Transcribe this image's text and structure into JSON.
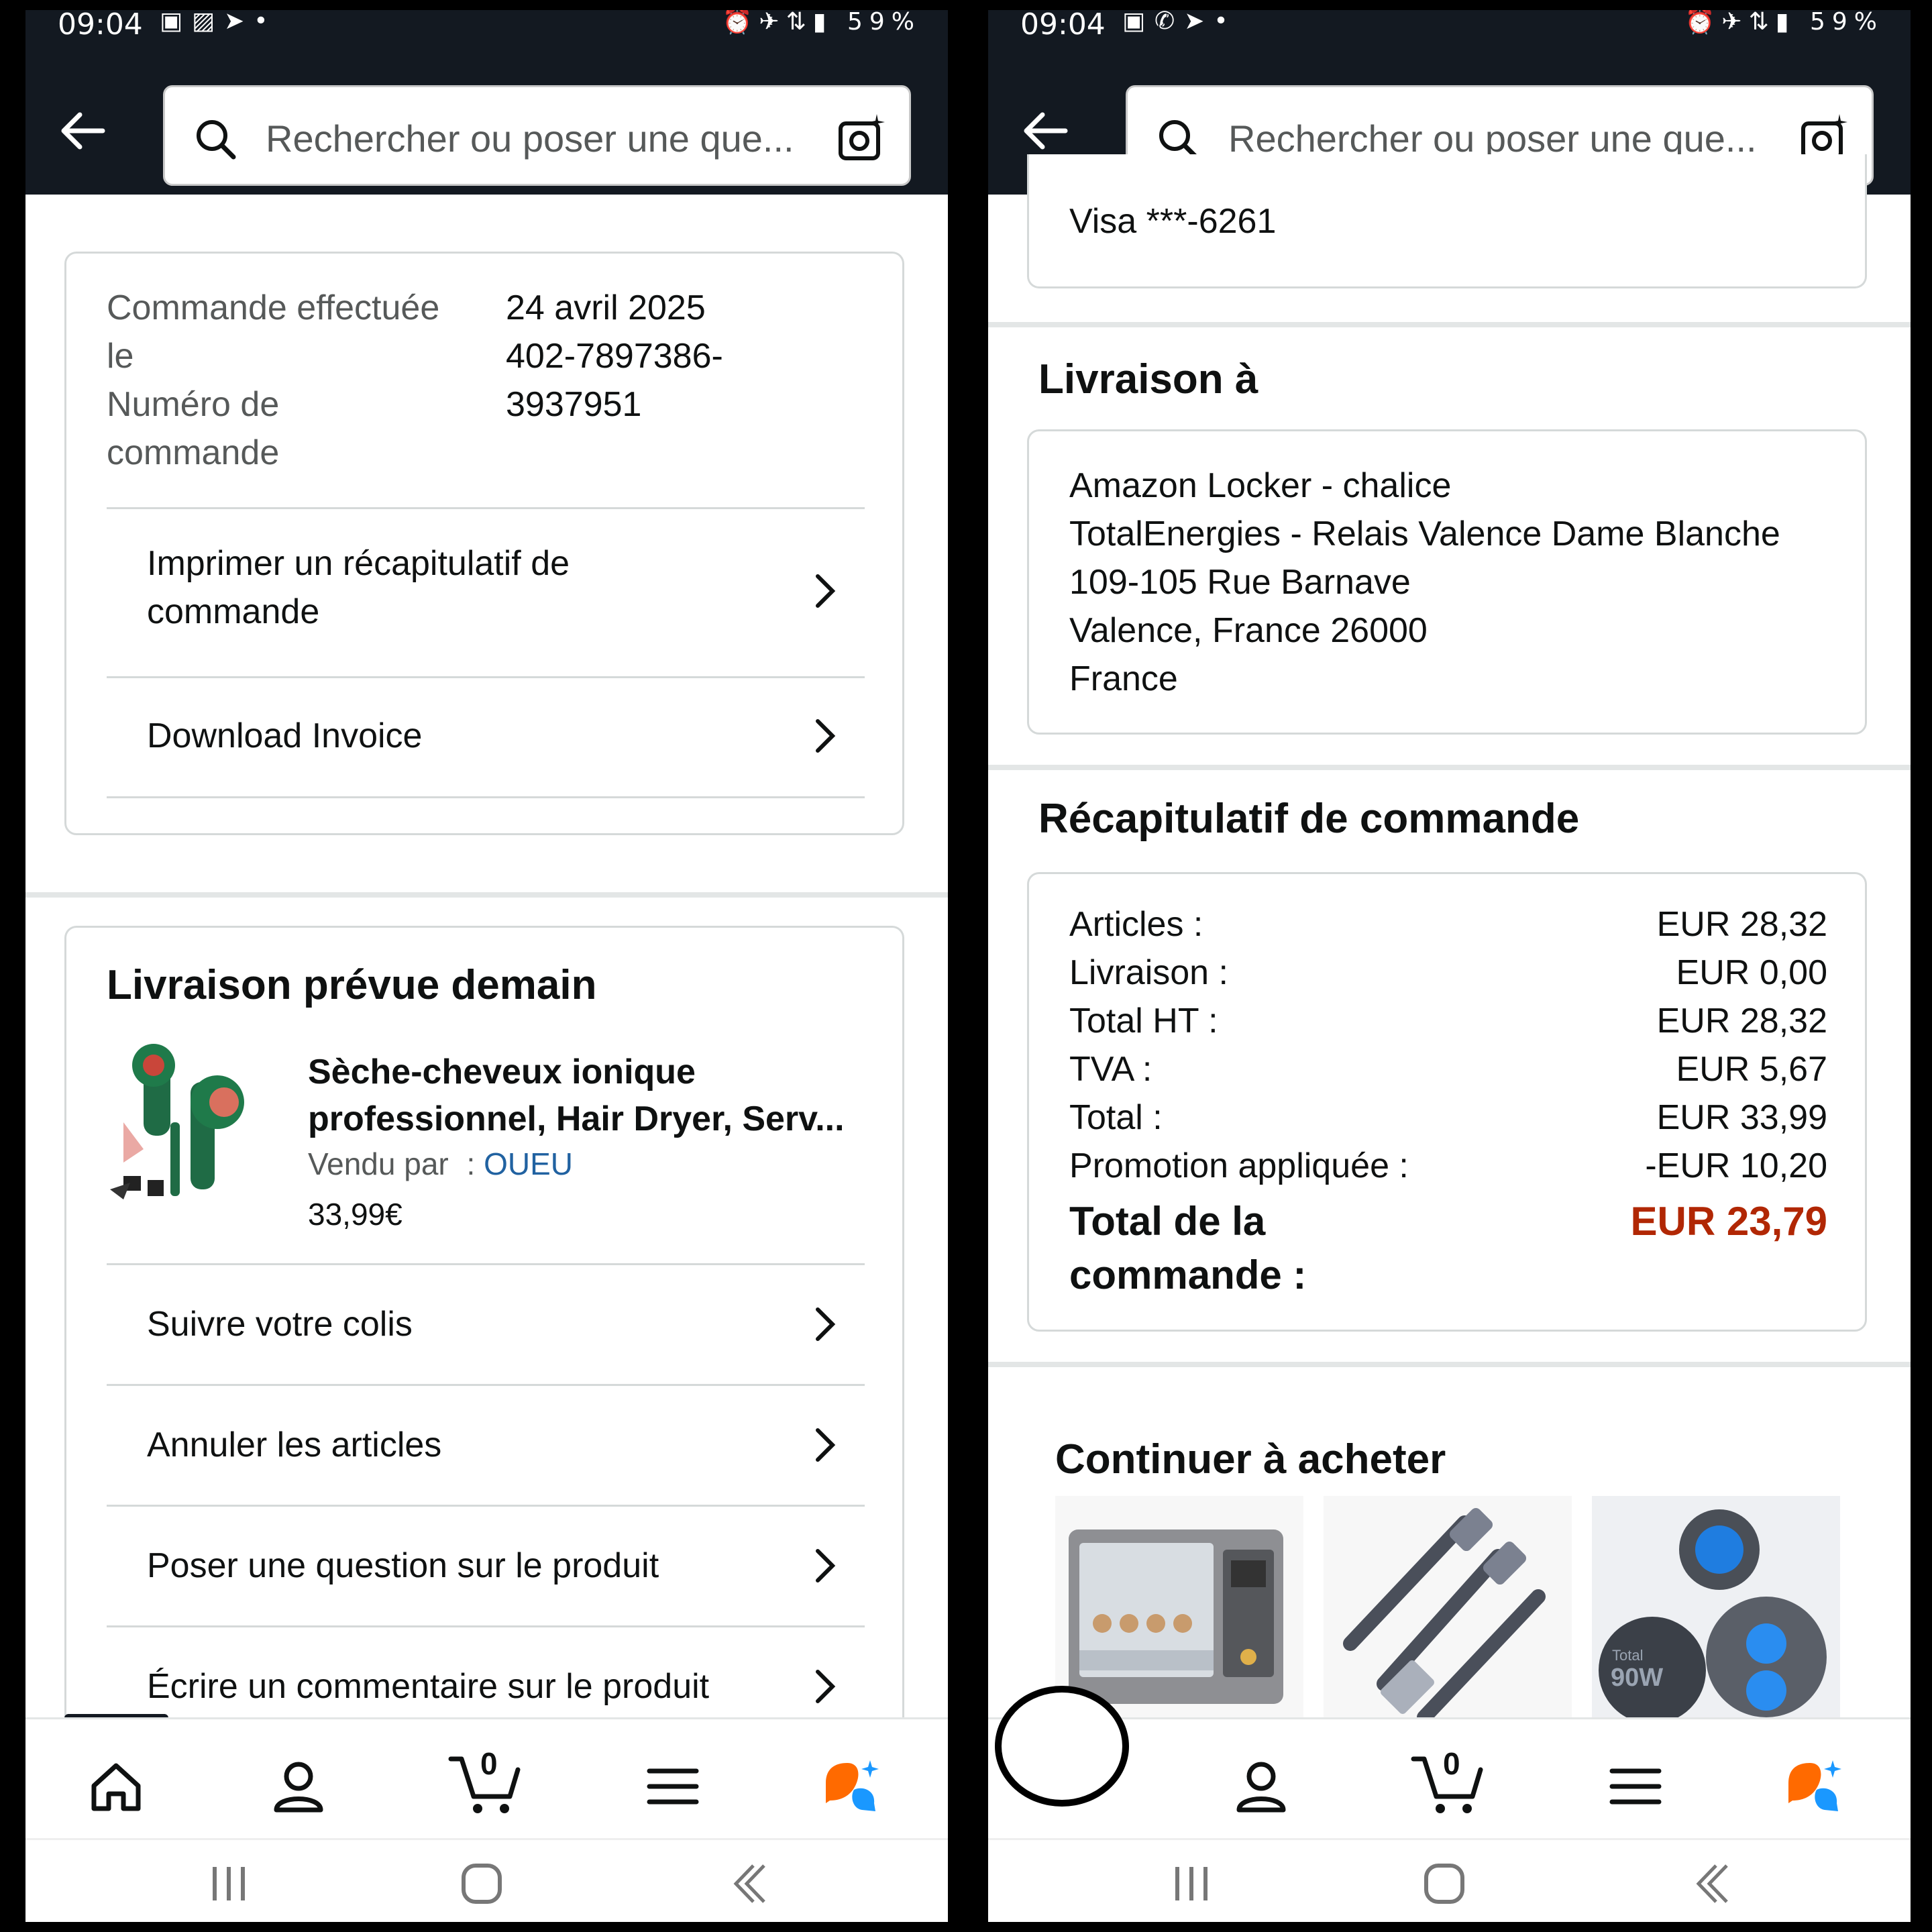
{
  "status": {
    "time": "09:04",
    "battery": "59%"
  },
  "search": {
    "placeholder": "Rechercher ou poser une que..."
  },
  "order": {
    "placed_label": "Commande effectuée le",
    "placed_label_l1": "Commande effectuée",
    "placed_label_l2": "le",
    "number_label_l1": "Numéro de",
    "number_label_l2": "commande",
    "date": "24 avril 2025",
    "number_l1": "402-7897386-",
    "number_l2": "3937951",
    "links": [
      {
        "label_l1": "Imprimer un récapitulatif de",
        "label_l2": "commande"
      },
      {
        "label_l1": "Download Invoice"
      }
    ]
  },
  "delivery": {
    "heading": "Livraison prévue demain",
    "product": {
      "title_l1": "Sèche-cheveux ionique",
      "title_l2": "professionnel, Hair Dryer, Serv...",
      "sold_by_label": "Vendu par",
      "sold_by_sep": ":",
      "seller": "OUEU",
      "price": "33,99€"
    },
    "actions": [
      "Suivre votre colis",
      "Annuler les articles",
      "Poser une question sur le produit",
      "Écrire un commentaire sur le produit"
    ]
  },
  "payment": {
    "card": "Visa ***-6261"
  },
  "shipping": {
    "heading": "Livraison à",
    "address": [
      "Amazon Locker - chalice",
      "TotalEnergies - Relais Valence Dame Blanche",
      "109-105 Rue Barnave",
      "Valence, France 26000",
      "France"
    ]
  },
  "summary": {
    "heading": "Récapitulatif de commande",
    "rows": [
      {
        "label": "Articles :",
        "value": "EUR 28,32"
      },
      {
        "label": "Livraison :",
        "value": "EUR 0,00"
      },
      {
        "label": "Total HT :",
        "value": "EUR 28,32"
      },
      {
        "label": "TVA :",
        "value": "EUR 5,67"
      },
      {
        "label": "Total :",
        "value": "EUR 33,99"
      },
      {
        "label": "Promotion appliquée :",
        "value": "-EUR 10,20"
      }
    ],
    "grand_label_l1": "Total de la",
    "grand_label_l2": "commande :",
    "grand_value": "EUR 23,79",
    "grand_color": "#b12704"
  },
  "continue": {
    "heading": "Continuer à acheter",
    "items": [
      "oven-incubator",
      "usb-c-cable",
      "car-charger"
    ],
    "charger_text": "90W",
    "charger_small": "Total"
  },
  "nav": {
    "cart_count": "0",
    "items": [
      "home",
      "account",
      "cart",
      "menu",
      "rufus"
    ]
  },
  "colors": {
    "header": "#131921",
    "link": "#2162a1",
    "price_red": "#b12704"
  }
}
